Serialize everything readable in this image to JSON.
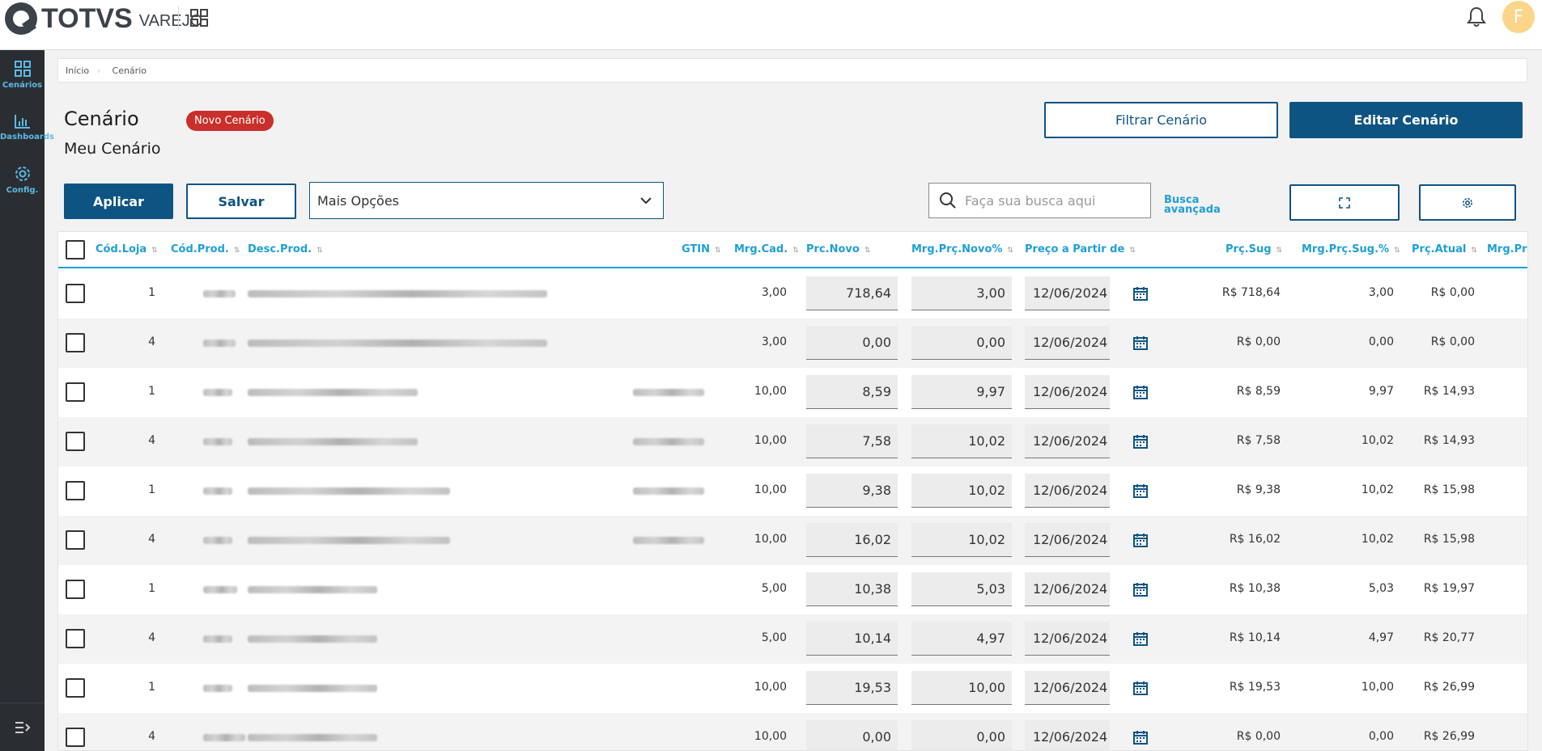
{
  "brand": {
    "name": "TOTVS",
    "product": "VAREJO"
  },
  "user": {
    "initial": "F"
  },
  "sidebar": {
    "items": [
      {
        "label": "Cenários",
        "icon": "grid-icon"
      },
      {
        "label": "Dashboards",
        "icon": "bar-chart-icon"
      },
      {
        "label": "Config.",
        "icon": "gear-icon"
      }
    ]
  },
  "breadcrumb": {
    "home": "Início",
    "current": "Cenário"
  },
  "header": {
    "title": "Cenário",
    "badge": "Novo Cenário",
    "subtitle": "Meu Cenário",
    "filter_label": "Filtrar Cenário",
    "edit_label": "Editar Cenário"
  },
  "toolbar": {
    "apply_label": "Aplicar",
    "save_label": "Salvar",
    "more_options": "Mais Opções",
    "search_placeholder": "Faça sua busca aqui",
    "advanced_search_1": "Busca",
    "advanced_search_2": "avançada"
  },
  "table": {
    "columns": {
      "store": "Cód.Loja",
      "product": "Cód.Prod.",
      "desc": "Desc.Prod.",
      "gtin": "GTIN",
      "mrg_cad": "Mrg.Cad.",
      "prc_novo": "Prc.Novo",
      "mrg_prc_novo": "Mrg.Prç.Novo%",
      "from_date": "Preço a Partir de",
      "prc_sug": "Prç.Sug",
      "mrg_prc_sug": "Mrg.Prç.Sug.%",
      "prc_atual": "Prç.Atual",
      "mrg_prc": "Mrg.Prç"
    },
    "rows": [
      {
        "store": "1",
        "mrg_cad": "3,00",
        "prc_novo": "718,64",
        "mrg_novo": "3,00",
        "date": "12/06/2024",
        "prc_sug": "R$ 718,64",
        "mrg_sug": "3,00",
        "prc_atual": "R$ 0,00"
      },
      {
        "store": "4",
        "mrg_cad": "3,00",
        "prc_novo": "0,00",
        "mrg_novo": "0,00",
        "date": "12/06/2024",
        "prc_sug": "R$ 0,00",
        "mrg_sug": "0,00",
        "prc_atual": "R$ 0,00"
      },
      {
        "store": "1",
        "mrg_cad": "10,00",
        "prc_novo": "8,59",
        "mrg_novo": "9,97",
        "date": "12/06/2024",
        "prc_sug": "R$ 8,59",
        "mrg_sug": "9,97",
        "prc_atual": "R$ 14,93"
      },
      {
        "store": "4",
        "mrg_cad": "10,00",
        "prc_novo": "7,58",
        "mrg_novo": "10,02",
        "date": "12/06/2024",
        "prc_sug": "R$ 7,58",
        "mrg_sug": "10,02",
        "prc_atual": "R$ 14,93"
      },
      {
        "store": "1",
        "mrg_cad": "10,00",
        "prc_novo": "9,38",
        "mrg_novo": "10,02",
        "date": "12/06/2024",
        "prc_sug": "R$ 9,38",
        "mrg_sug": "10,02",
        "prc_atual": "R$ 15,98"
      },
      {
        "store": "4",
        "mrg_cad": "10,00",
        "prc_novo": "16,02",
        "mrg_novo": "10,02",
        "date": "12/06/2024",
        "prc_sug": "R$ 16,02",
        "mrg_sug": "10,02",
        "prc_atual": "R$ 15,98"
      },
      {
        "store": "1",
        "mrg_cad": "5,00",
        "prc_novo": "10,38",
        "mrg_novo": "5,03",
        "date": "12/06/2024",
        "prc_sug": "R$ 10,38",
        "mrg_sug": "5,03",
        "prc_atual": "R$ 19,97"
      },
      {
        "store": "4",
        "mrg_cad": "5,00",
        "prc_novo": "10,14",
        "mrg_novo": "4,97",
        "date": "12/06/2024",
        "prc_sug": "R$ 10,14",
        "mrg_sug": "4,97",
        "prc_atual": "R$ 20,77"
      },
      {
        "store": "1",
        "mrg_cad": "10,00",
        "prc_novo": "19,53",
        "mrg_novo": "10,00",
        "date": "12/06/2024",
        "prc_sug": "R$ 19,53",
        "mrg_sug": "10,00",
        "prc_atual": "R$ 26,99"
      },
      {
        "store": "4",
        "mrg_cad": "10,00",
        "prc_novo": "0,00",
        "mrg_novo": "0,00",
        "date": "12/06/2024",
        "prc_sug": "R$ 0,00",
        "mrg_sug": "0,00",
        "prc_atual": "R$ 26,99"
      }
    ]
  },
  "colors": {
    "primary": "#0e5483",
    "accent": "#1f9fd6",
    "badge": "#c9302c",
    "sidebar": "#2a2e33"
  }
}
